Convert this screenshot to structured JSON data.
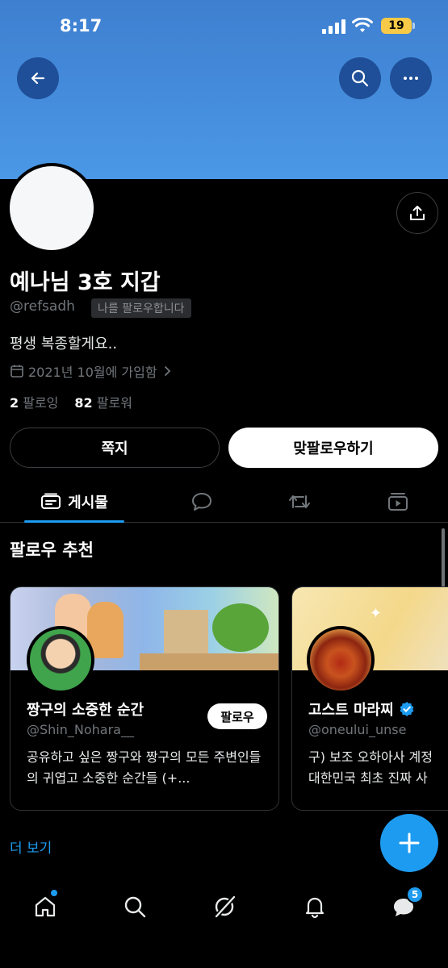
{
  "status_bar": {
    "time": "8:17",
    "battery": "19"
  },
  "header": {
    "back_icon": "arrow-left-icon",
    "search_icon": "search-icon",
    "more_icon": "more-horizontal-icon",
    "banner_color": "#4a98e6"
  },
  "profile": {
    "display_name": "예나님 3호 지갑",
    "handle": "@refsadh",
    "follows_you": "나를 팔로우합니다",
    "bio": "평생 복종할게요..",
    "joined": "2021년 10월에 가입함",
    "following_count": "2",
    "following_label": "팔로잉",
    "followers_count": "82",
    "followers_label": "팔로워",
    "share_icon": "share-icon"
  },
  "actions": {
    "message_label": "쪽지",
    "follow_back_label": "맞팔로우하기"
  },
  "tabs": [
    {
      "label": "게시물",
      "icon": "posts-icon",
      "active": true
    },
    {
      "label": "",
      "icon": "reply-icon"
    },
    {
      "label": "",
      "icon": "repost-icon"
    },
    {
      "label": "",
      "icon": "media-icon"
    }
  ],
  "suggestions": {
    "title": "팔로우 추천",
    "cards": [
      {
        "name": "짱구의 소중한 순간",
        "handle": "@Shin_Nohara__",
        "description": "공유하고 싶은 짱구와 짱구의 모든 주변인들의 귀엽고 소중한 순간들 (+...",
        "follow_label": "팔로우"
      },
      {
        "name": "고스트 마라찌",
        "handle": "@oneului_unse",
        "description_line1": "구) 보조 오하아사 계정",
        "description_line2": "대한민국 최초 진짜 사",
        "verified_icon": "verified-badge-icon"
      }
    ],
    "more_label": "더 보기"
  },
  "fab": {
    "icon": "plus-icon"
  },
  "bottom_nav": {
    "items": [
      "home-icon",
      "search-icon",
      "grok-icon",
      "notifications-icon",
      "messages-icon"
    ],
    "messages_badge": "5"
  },
  "colors": {
    "accent": "#1d9bf0",
    "background": "#000000",
    "muted_text": "#71767b"
  }
}
